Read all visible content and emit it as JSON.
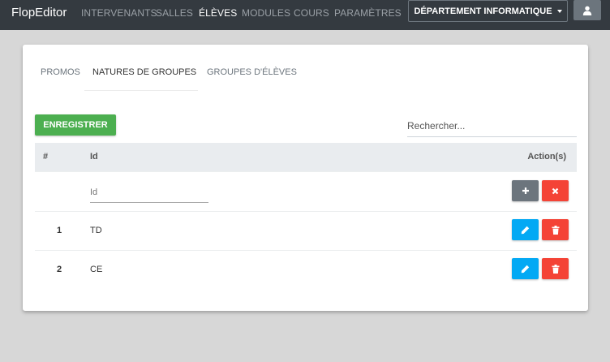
{
  "navbar": {
    "brand": "FlopEditor",
    "items": [
      {
        "label": "INTERVENANTS",
        "active": false
      },
      {
        "label": "SALLES",
        "active": false
      },
      {
        "label": "ÉLÈVES",
        "active": true
      },
      {
        "label": "MODULES",
        "active": false
      },
      {
        "label": "COURS",
        "active": false
      },
      {
        "label": "PARAMÈTRES",
        "active": false
      }
    ],
    "department": "DÉPARTEMENT INFORMATIQUE",
    "user_icon": "user-icon"
  },
  "tabs": [
    {
      "label": "PROMOS",
      "active": false
    },
    {
      "label": "NATURES DE GROUPES",
      "active": true
    },
    {
      "label": "GROUPES D'ÉLÈVES",
      "active": false
    }
  ],
  "toolbar": {
    "save_label": "ENREGISTRER",
    "search_placeholder": "Rechercher..."
  },
  "table": {
    "columns": {
      "num": "#",
      "id": "Id",
      "actions": "Action(s)"
    },
    "new_row": {
      "id_placeholder": "Id",
      "add_icon": "plus-icon",
      "clear_icon": "close-icon"
    },
    "rows": [
      {
        "num": "1",
        "id": "TD"
      },
      {
        "num": "2",
        "id": "CE"
      }
    ],
    "row_icons": {
      "edit": "pencil-icon",
      "delete": "trash-icon"
    }
  },
  "colors": {
    "navbar": "#343a40",
    "save": "#4caf50",
    "edit": "#03a9f4",
    "delete": "#f44336",
    "add": "#6c757d"
  }
}
